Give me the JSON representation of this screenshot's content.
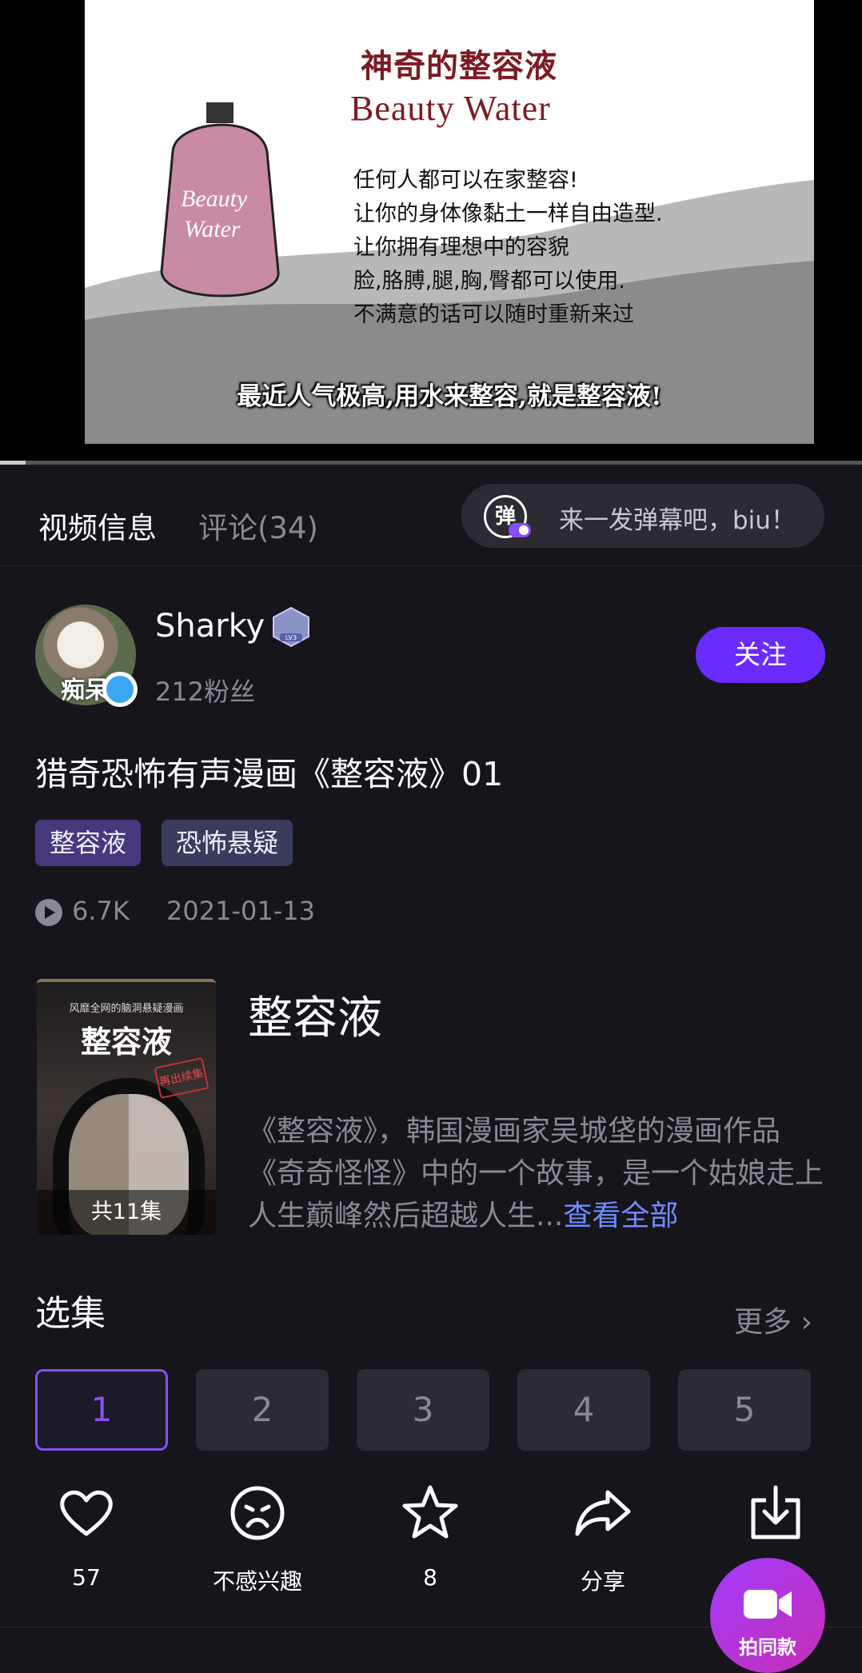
{
  "video": {
    "frame_title_cn": "神奇的整容液",
    "frame_title_en": "Beauty Water",
    "bottle_label_line1": "Beauty",
    "bottle_label_line2": "Water",
    "frame_lines": [
      "任何人都可以在家整容!",
      "让你的身体像黏土一样自由造型.",
      "让你拥有理想中的容貌",
      "脸,胳膊,腿,胸,臀都可以使用.",
      "不满意的话可以随时重新来过"
    ],
    "subtitle": "最近人气极高,用水来整容,就是整容液!",
    "progress_fraction": 0.03
  },
  "tabs": {
    "info": "视频信息",
    "comments": "评论(34)"
  },
  "danmaku": {
    "icon_char": "弹",
    "placeholder": "来一发弹幕吧，biu！"
  },
  "author": {
    "avatar_text": "痴呆",
    "name": "Sharky",
    "level": "LV3",
    "fans": "212粉丝",
    "follow_label": "关注"
  },
  "video_info": {
    "title": "猎奇恐怖有声漫画《整容液》01",
    "tags": [
      "整容液",
      "恐怖悬疑"
    ],
    "views": "6.7K",
    "date": "2021-01-13"
  },
  "comic": {
    "cover_top_text": "风靡全网的脑洞悬疑漫画",
    "cover_name": "整容液",
    "cover_stamp": "再出续集",
    "episode_count": "共11集",
    "title": "整容液",
    "description": "《整容液》，韩国漫画家吴城垡的漫画作品《奇奇怪怪》中的一个故事，是一个姑娘走上人生巅峰然后超越人生...",
    "see_all": "查看全部"
  },
  "episodes": {
    "section_title": "选集",
    "more_label": "更多 ›",
    "items": [
      "1",
      "2",
      "3",
      "4",
      "5"
    ],
    "selected": "1"
  },
  "actions": {
    "like_count": "57",
    "dislike_label": "不感兴趣",
    "favorite_count": "8",
    "share_label": "分享",
    "shoot_label": "拍同款"
  },
  "colors": {
    "background": "#17151c",
    "accent": "#6a2bff",
    "link": "#6e8dff",
    "muted_text": "#8a8890"
  }
}
